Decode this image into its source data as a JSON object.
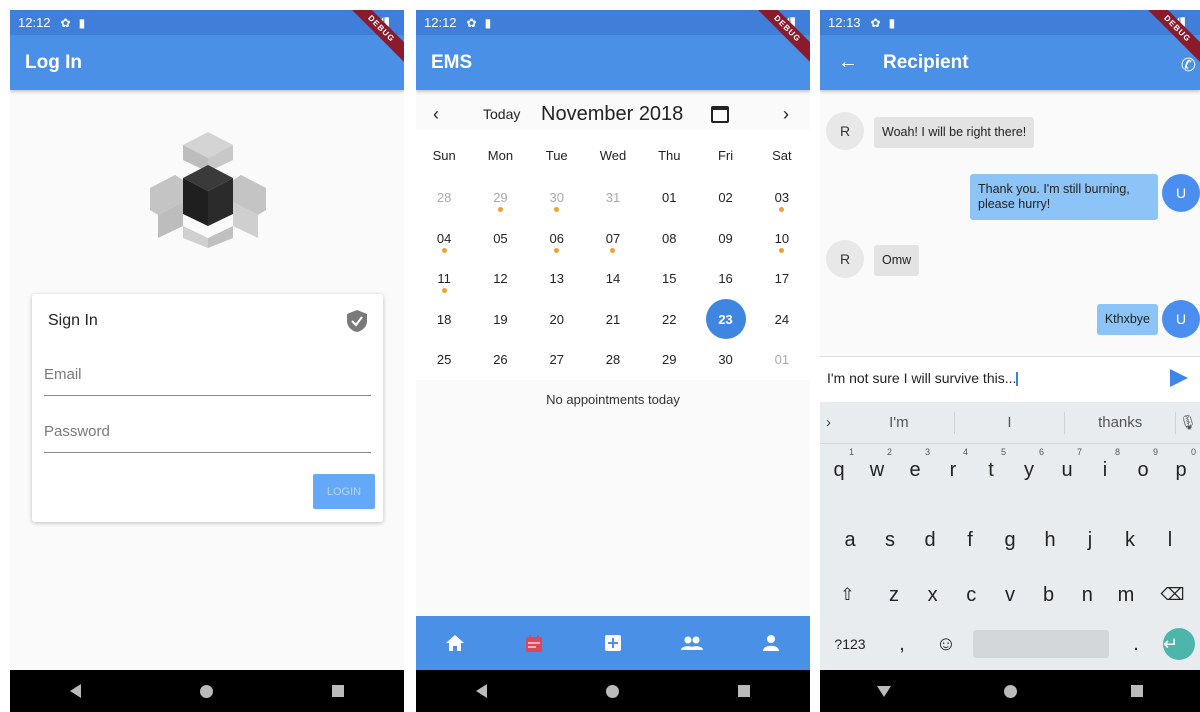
{
  "status": {
    "phone1_time": "12:12",
    "phone2_time": "12:12",
    "phone3_time": "12:13",
    "debug_label": "DEBUG"
  },
  "login_screen": {
    "title": "Log In",
    "card_title": "Sign In",
    "email_placeholder": "Email",
    "password_placeholder": "Password",
    "login_button": "LOGIN",
    "button_color": "#64a8f8"
  },
  "calendar_screen": {
    "title": "EMS",
    "today_label": "Today",
    "month_label": "November 2018",
    "weekdays": [
      "Sun",
      "Mon",
      "Tue",
      "Wed",
      "Thu",
      "Fri",
      "Sat"
    ],
    "weeks": [
      [
        {
          "d": "28",
          "muted": true
        },
        {
          "d": "29",
          "muted": true,
          "dot": true
        },
        {
          "d": "30",
          "muted": true,
          "dot": true
        },
        {
          "d": "31",
          "muted": true
        },
        {
          "d": "01"
        },
        {
          "d": "02"
        },
        {
          "d": "03",
          "dot": true
        }
      ],
      [
        {
          "d": "04",
          "dot": true
        },
        {
          "d": "05"
        },
        {
          "d": "06",
          "dot": true
        },
        {
          "d": "07",
          "dot": true
        },
        {
          "d": "08"
        },
        {
          "d": "09"
        },
        {
          "d": "10",
          "dot": true
        }
      ],
      [
        {
          "d": "11",
          "dot": true
        },
        {
          "d": "12"
        },
        {
          "d": "13"
        },
        {
          "d": "14"
        },
        {
          "d": "15"
        },
        {
          "d": "16"
        },
        {
          "d": "17"
        }
      ],
      [
        {
          "d": "18"
        },
        {
          "d": "19"
        },
        {
          "d": "20"
        },
        {
          "d": "21"
        },
        {
          "d": "22"
        },
        {
          "d": "23",
          "selected": true
        },
        {
          "d": "24"
        }
      ],
      [
        {
          "d": "25"
        },
        {
          "d": "26"
        },
        {
          "d": "27"
        },
        {
          "d": "28"
        },
        {
          "d": "29"
        },
        {
          "d": "30"
        },
        {
          "d": "01",
          "muted": true
        }
      ]
    ],
    "empty_message": "No appointments today",
    "selected_color": "#3f86e0",
    "event_dot_color": "#f0a030",
    "bottom_nav": [
      "home-icon",
      "calendar-icon",
      "add-box-icon",
      "people-icon",
      "person-icon"
    ]
  },
  "chat_screen": {
    "title": "Recipient",
    "messages": [
      {
        "from": "R",
        "text": "Woah! I will be right there!",
        "incoming": true
      },
      {
        "from": "U",
        "text": "Thank you. I'm still burning, please hurry!",
        "incoming": false
      },
      {
        "from": "R",
        "text": "Omw",
        "incoming": true
      },
      {
        "from": "U",
        "text": "Kthxbye",
        "incoming": false
      }
    ],
    "input_value": "I'm not sure I will survive this...",
    "suggestions": [
      "I'm",
      "I",
      "thanks"
    ],
    "keyboard": {
      "row1": [
        "q",
        "w",
        "e",
        "r",
        "t",
        "y",
        "u",
        "i",
        "o",
        "p"
      ],
      "row1_hints": [
        "1",
        "2",
        "3",
        "4",
        "5",
        "6",
        "7",
        "8",
        "9",
        "0"
      ],
      "row2": [
        "a",
        "s",
        "d",
        "f",
        "g",
        "h",
        "j",
        "k",
        "l"
      ],
      "row3": [
        "z",
        "x",
        "c",
        "v",
        "b",
        "n",
        "m"
      ],
      "symbols_key": "?123",
      "comma_key": ",",
      "period_key": "."
    }
  }
}
